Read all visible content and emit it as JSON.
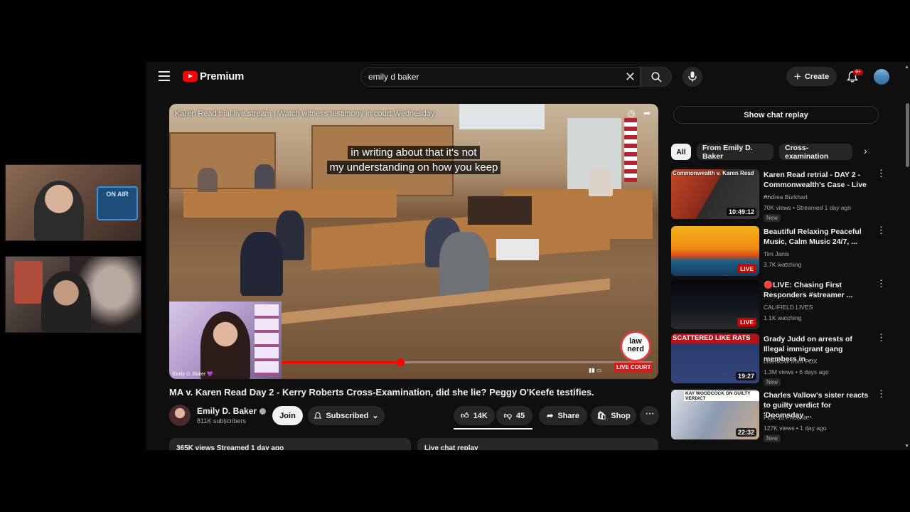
{
  "header": {
    "logo_text": "Premium",
    "search_value": "emily d baker",
    "create_label": "Create",
    "notifications_badge": "9+"
  },
  "webcam_overlay": {
    "sign_text": "ON AIR"
  },
  "player": {
    "title": "Karen Read trial live stream | Watch witness testimony in court Wednesday",
    "caption_line1": "in writing about that it's not",
    "caption_line2": "my understanding on how you keep",
    "pip_name": "Emily D. Baker 💜",
    "watermark_text": "law nerd",
    "live_badge": "LIVE COURT",
    "progress": 0.32
  },
  "video": {
    "title": "MA v. Karen Read Day 2 - Kerry Roberts Cross-Examination, did she lie? Peggy O'Keefe testifies.",
    "channel_name": "Emily D. Baker",
    "subscribers": "811K subscribers",
    "join_label": "Join",
    "subscribed_label": "Subscribed",
    "like_count": "14K",
    "dislike_count": "45",
    "share_label": "Share",
    "shop_label": "Shop",
    "desc_left": "365K views  Streamed 1 day ago",
    "desc_right": "Live chat replay"
  },
  "sidebar": {
    "chat_replay_label": "Show chat replay",
    "chips": [
      "All",
      "From Emily D. Baker",
      "Cross-examination"
    ],
    "recommendations": [
      {
        "title": "Karen Read retrial - DAY 2 - Commonwealth's Case - Live ...",
        "channel": "Andrea Burkhart",
        "meta": "70K views • Streamed 1 day ago",
        "badge": "New",
        "duration": "10:49:12"
      },
      {
        "title": "Beautiful Relaxing Peaceful Music, Calm Music 24/7, ...",
        "channel": "Tim Janis",
        "meta": "3.7K watching",
        "badge": "",
        "duration": "LIVE"
      },
      {
        "title": "🔴LIVE: Chasing First Responders #streamer ...",
        "channel": "CALIFIELD LIVES",
        "meta": "1.1K watching",
        "badge": "",
        "duration": "LIVE"
      },
      {
        "title": "Grady Judd on arrests of Illegal immigrant gang members in ...",
        "channel": "LiveNOW from FOX",
        "meta": "1.3M views • 6 days ago",
        "badge": "New",
        "duration": "19:27"
      },
      {
        "title": "Charles Vallow's sister reacts to guilty verdict for 'Doomsday ...",
        "channel": "FOX 10 Phoenix",
        "meta": "127K views • 1 day ago",
        "badge": "New",
        "duration": "22:32"
      }
    ],
    "thumb_texts": [
      "Commonwealth v. Karen Read",
      "SCATTERED LIKE RATS",
      "KAY WOODCOCK ON GUILTY VERDICT"
    ]
  },
  "colors": {
    "background": "#0f0f0f",
    "accent": "#ff0000",
    "chip": "#272727"
  }
}
